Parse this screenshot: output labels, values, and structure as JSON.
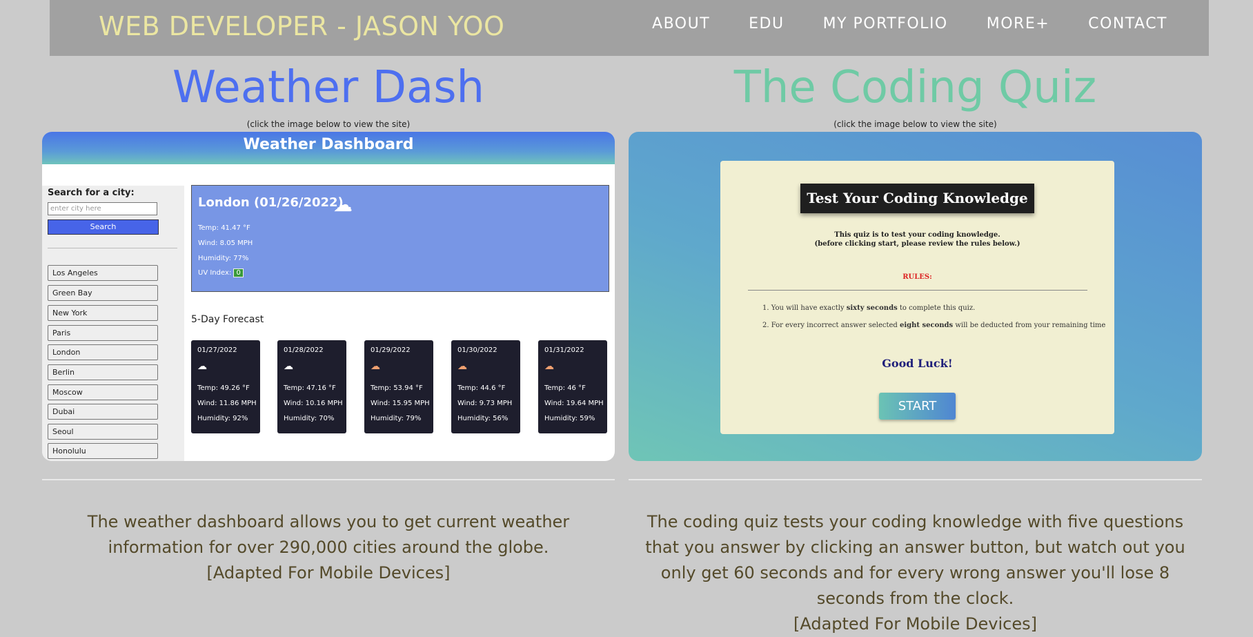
{
  "header": {
    "brand": "WEB DEVELOPER - JASON YOO",
    "nav": [
      "ABOUT",
      "EDU",
      "MY PORTFOLIO",
      "MORE+",
      "CONTACT"
    ]
  },
  "projects": {
    "weather": {
      "title": "Weather Dash",
      "hint": "(click the image below to view the site)",
      "description_1": "The weather dashboard allows you to get current weather information for over 290,000 cities around the globe.",
      "description_2": "[Adapted For Mobile Devices]",
      "preview": {
        "header": "Weather Dashboard",
        "search_label": "Search for a city:",
        "search_placeholder": "enter city here",
        "search_button": "Search",
        "cities": [
          "Los Angeles",
          "Green Bay",
          "New York",
          "Paris",
          "London",
          "Berlin",
          "Moscow",
          "Dubai",
          "Seoul",
          "Honolulu"
        ],
        "current": {
          "title": "London  (01/26/2022)",
          "icon": "cloud-icon",
          "temp": "Temp: 41.47 °F",
          "wind": "Wind: 8.05 MPH",
          "humidity": "Humidity: 77%",
          "uv_label": "UV Index:",
          "uv_value": "0"
        },
        "forecast_label": "5-Day Forecast",
        "forecast": [
          {
            "date": "01/27/2022",
            "icon": "cloud-icon",
            "temp": "Temp: 49.26 °F",
            "wind": "Wind: 11.86 MPH",
            "humidity": "Humidity: 92%"
          },
          {
            "date": "01/28/2022",
            "icon": "cloud-icon",
            "temp": "Temp: 47.16 °F",
            "wind": "Wind: 10.16 MPH",
            "humidity": "Humidity: 70%"
          },
          {
            "date": "01/29/2022",
            "icon": "partly-cloudy-icon",
            "temp": "Temp: 53.94 °F",
            "wind": "Wind: 15.95 MPH",
            "humidity": "Humidity: 79%"
          },
          {
            "date": "01/30/2022",
            "icon": "partly-cloudy-icon",
            "temp": "Temp: 44.6 °F",
            "wind": "Wind: 9.73 MPH",
            "humidity": "Humidity: 56%"
          },
          {
            "date": "01/31/2022",
            "icon": "partly-cloudy-icon",
            "temp": "Temp: 46 °F",
            "wind": "Wind: 19.64 MPH",
            "humidity": "Humidity: 59%"
          }
        ]
      }
    },
    "quiz": {
      "title": "The Coding Quiz",
      "hint": "(click the image below to view the site)",
      "description_1": "The coding quiz tests your coding knowledge with five questions that you answer by clicking an answer button, but watch out you only get 60 seconds and for every wrong answer you'll lose 8 seconds from the clock.",
      "description_2": "[Adapted For Mobile Devices]",
      "preview": {
        "heading": "Test Your Coding Knowledge",
        "intro_1": "This quiz is to test your coding knowledge.",
        "intro_2": "(before clicking start, please review the rules below.)",
        "rules_label": "RULES:",
        "rule_1_a": "1. You will have exactly ",
        "rule_1_b": "sixty seconds",
        "rule_1_c": " to complete this quiz.",
        "rule_2_a": "2. For every incorrect answer selected ",
        "rule_2_b": "eight seconds",
        "rule_2_c": " will be deducted from your remaining time",
        "good_luck": "Good Luck!",
        "start": "START"
      }
    }
  },
  "colors": {
    "background": "#cbcbcb",
    "navbar": "#a1a1a1",
    "brand": "#ebe6a2",
    "weather_title": "#4d6ff0",
    "quiz_title": "#6fcaa5",
    "description": "#544a2a"
  }
}
